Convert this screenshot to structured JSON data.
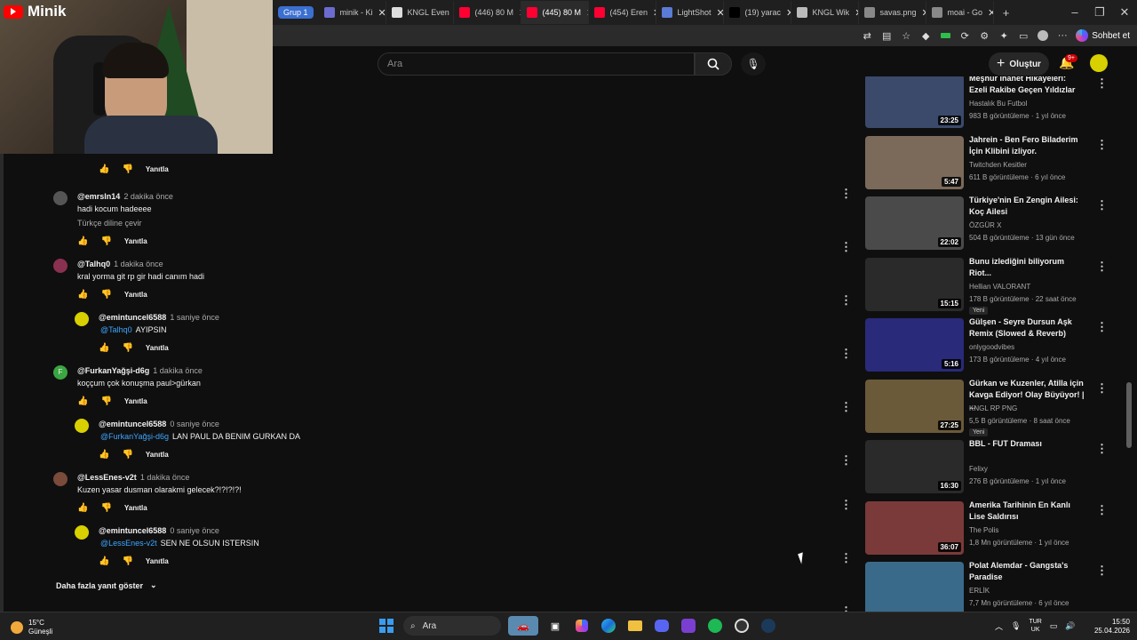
{
  "browser": {
    "group_label": "Grup 1",
    "tabs": [
      {
        "label": "minik - Ki",
        "color": "#6b6bd0"
      },
      {
        "label": "KNGL Even",
        "color": "#dddddd"
      },
      {
        "label": "(446) 80 M",
        "color": "#ff0033"
      },
      {
        "label": "(445) 80 M",
        "color": "#ff0033"
      },
      {
        "label": "(454) Eren",
        "color": "#ff0033"
      },
      {
        "label": "LightShot",
        "color": "#5a7bd6"
      },
      {
        "label": "(19) yarac",
        "color": "#000000"
      },
      {
        "label": "KNGL Wik",
        "color": "#bbbbbb"
      },
      {
        "label": "savas.png",
        "color": "#888888"
      },
      {
        "label": "moai - Go",
        "color": "#888888"
      }
    ],
    "chat_label": "Sohbet et"
  },
  "stream_overlay": {
    "channel": "Minik"
  },
  "youtube": {
    "search_placeholder": "Ara",
    "create_label": "Oluştur",
    "notif_badge": "9+"
  },
  "comments": [
    {
      "kind": "reply-tail",
      "reply": "Yanıtla"
    },
    {
      "author": "@emrsln14",
      "ago": "2 dakika önce",
      "text": "hadi kocum hadeeee",
      "translate": "Türkçe diline çevir",
      "reply": "Yanıtla",
      "avatar": "#555555"
    },
    {
      "author": "@Talhq0",
      "ago": "1 dakika önce",
      "text": "kral yorma git rp gir hadi canım hadi",
      "reply": "Yanıtla",
      "avatar": "#8a3050"
    },
    {
      "author": "@emintuncel6588",
      "ago": "1 saniye önce",
      "mention": "@Talhq0",
      "text": "AYIPSIN",
      "reply": "Yanıtla",
      "avatar": "#d8d000",
      "nested": true
    },
    {
      "author": "@FurkanYağşi-d6g",
      "ago": "1 dakika önce",
      "text": "koççum çok konuşma paul>gürkan",
      "reply": "Yanıtla",
      "avatar": "#3aa641",
      "initial": "F"
    },
    {
      "author": "@emintuncel6588",
      "ago": "0 saniye önce",
      "mention": "@FurkanYağşi-d6g",
      "text": "LAN PAUL DA BENIM GURKAN DA",
      "reply": "Yanıtla",
      "avatar": "#d8d000",
      "nested": true
    },
    {
      "author": "@LessEnes-v2t",
      "ago": "1 dakika önce",
      "text": "Kuzen yasar dusman olarakmi gelecek?!?!?!?!",
      "reply": "Yanıtla",
      "avatar": "#7a4a3a"
    },
    {
      "author": "@emintuncel6588",
      "ago": "0 saniye önce",
      "mention": "@LessEnes-v2t",
      "text": "SEN NE OLSUN ISTERSIN",
      "reply": "Yanıtla",
      "avatar": "#d8d000",
      "nested": true
    }
  ],
  "more_replies": "Daha fazla yanıt göster",
  "recommendations": [
    {
      "title": "Meşhur İhanet Hikayeleri: Ezeli Rakibe Geçen Yıldızlar",
      "channel": "Hastalık Bu Futbol",
      "meta": "983 B görüntüleme · 1 yıl önce",
      "duration": "23:25",
      "thumb": "#3b4a6b"
    },
    {
      "title": "Jahrein - Ben Fero Biladerim İçin Klibini izliyor.",
      "channel": "Twitchden Kesitler",
      "meta": "611 B görüntüleme · 6 yıl önce",
      "duration": "5:47",
      "thumb": "#7b6a5a"
    },
    {
      "title": "Türkiye'nin En Zengin Ailesi: Koç Ailesi",
      "channel": "ÖZGÜR X",
      "meta": "504 B görüntüleme · 13 gün önce",
      "duration": "22:02",
      "thumb": "#4a4a4a"
    },
    {
      "title": "Bunu izlediğini biliyorum Riot...",
      "channel": "Hellian VALORANT",
      "meta": "178 B görüntüleme · 22 saat önce",
      "duration": "15:15",
      "thumb": "#2a2a2a",
      "new": "Yeni"
    },
    {
      "title": "Gülşen - Seyre Dursun Aşk Remix (Slowed & Reverb)",
      "channel": "onlygoodvibes",
      "meta": "173 B görüntüleme · 4 yıl önce",
      "duration": "5:16",
      "thumb": "#2a2a7a"
    },
    {
      "title": "Gürkan ve Kuzenler, Atilla için Kavga Ediyor! Olay Büyüyor! | ...",
      "channel": "KNGL RP PNG",
      "meta": "5,5 B görüntüleme · 8 saat önce",
      "duration": "27:25",
      "thumb": "#6a5a3a",
      "new": "Yeni"
    },
    {
      "title": "BBL - FUT Draması",
      "channel": "Felixy",
      "meta": "276 B görüntüleme · 1 yıl önce",
      "duration": "16:30",
      "thumb": "#2a2a2a"
    },
    {
      "title": "Amerika Tarihinin En Kanlı Lise Saldırısı",
      "channel": "The Polis",
      "meta": "1,8 Mn görüntüleme · 1 yıl önce",
      "duration": "36:07",
      "thumb": "#7a3a3a"
    },
    {
      "title": "Polat Alemdar - Gangsta's Paradise",
      "channel": "ERLİK",
      "meta": "7,7 Mn görüntüleme · 6 yıl önce",
      "duration": "",
      "thumb": "#3a6a8a"
    }
  ],
  "taskbar": {
    "temp": "15°C",
    "weather": "Güneşli",
    "search": "Ara",
    "lang1": "TUR",
    "lang2": "UK",
    "time": "15:50",
    "date": "25.04.2026"
  }
}
